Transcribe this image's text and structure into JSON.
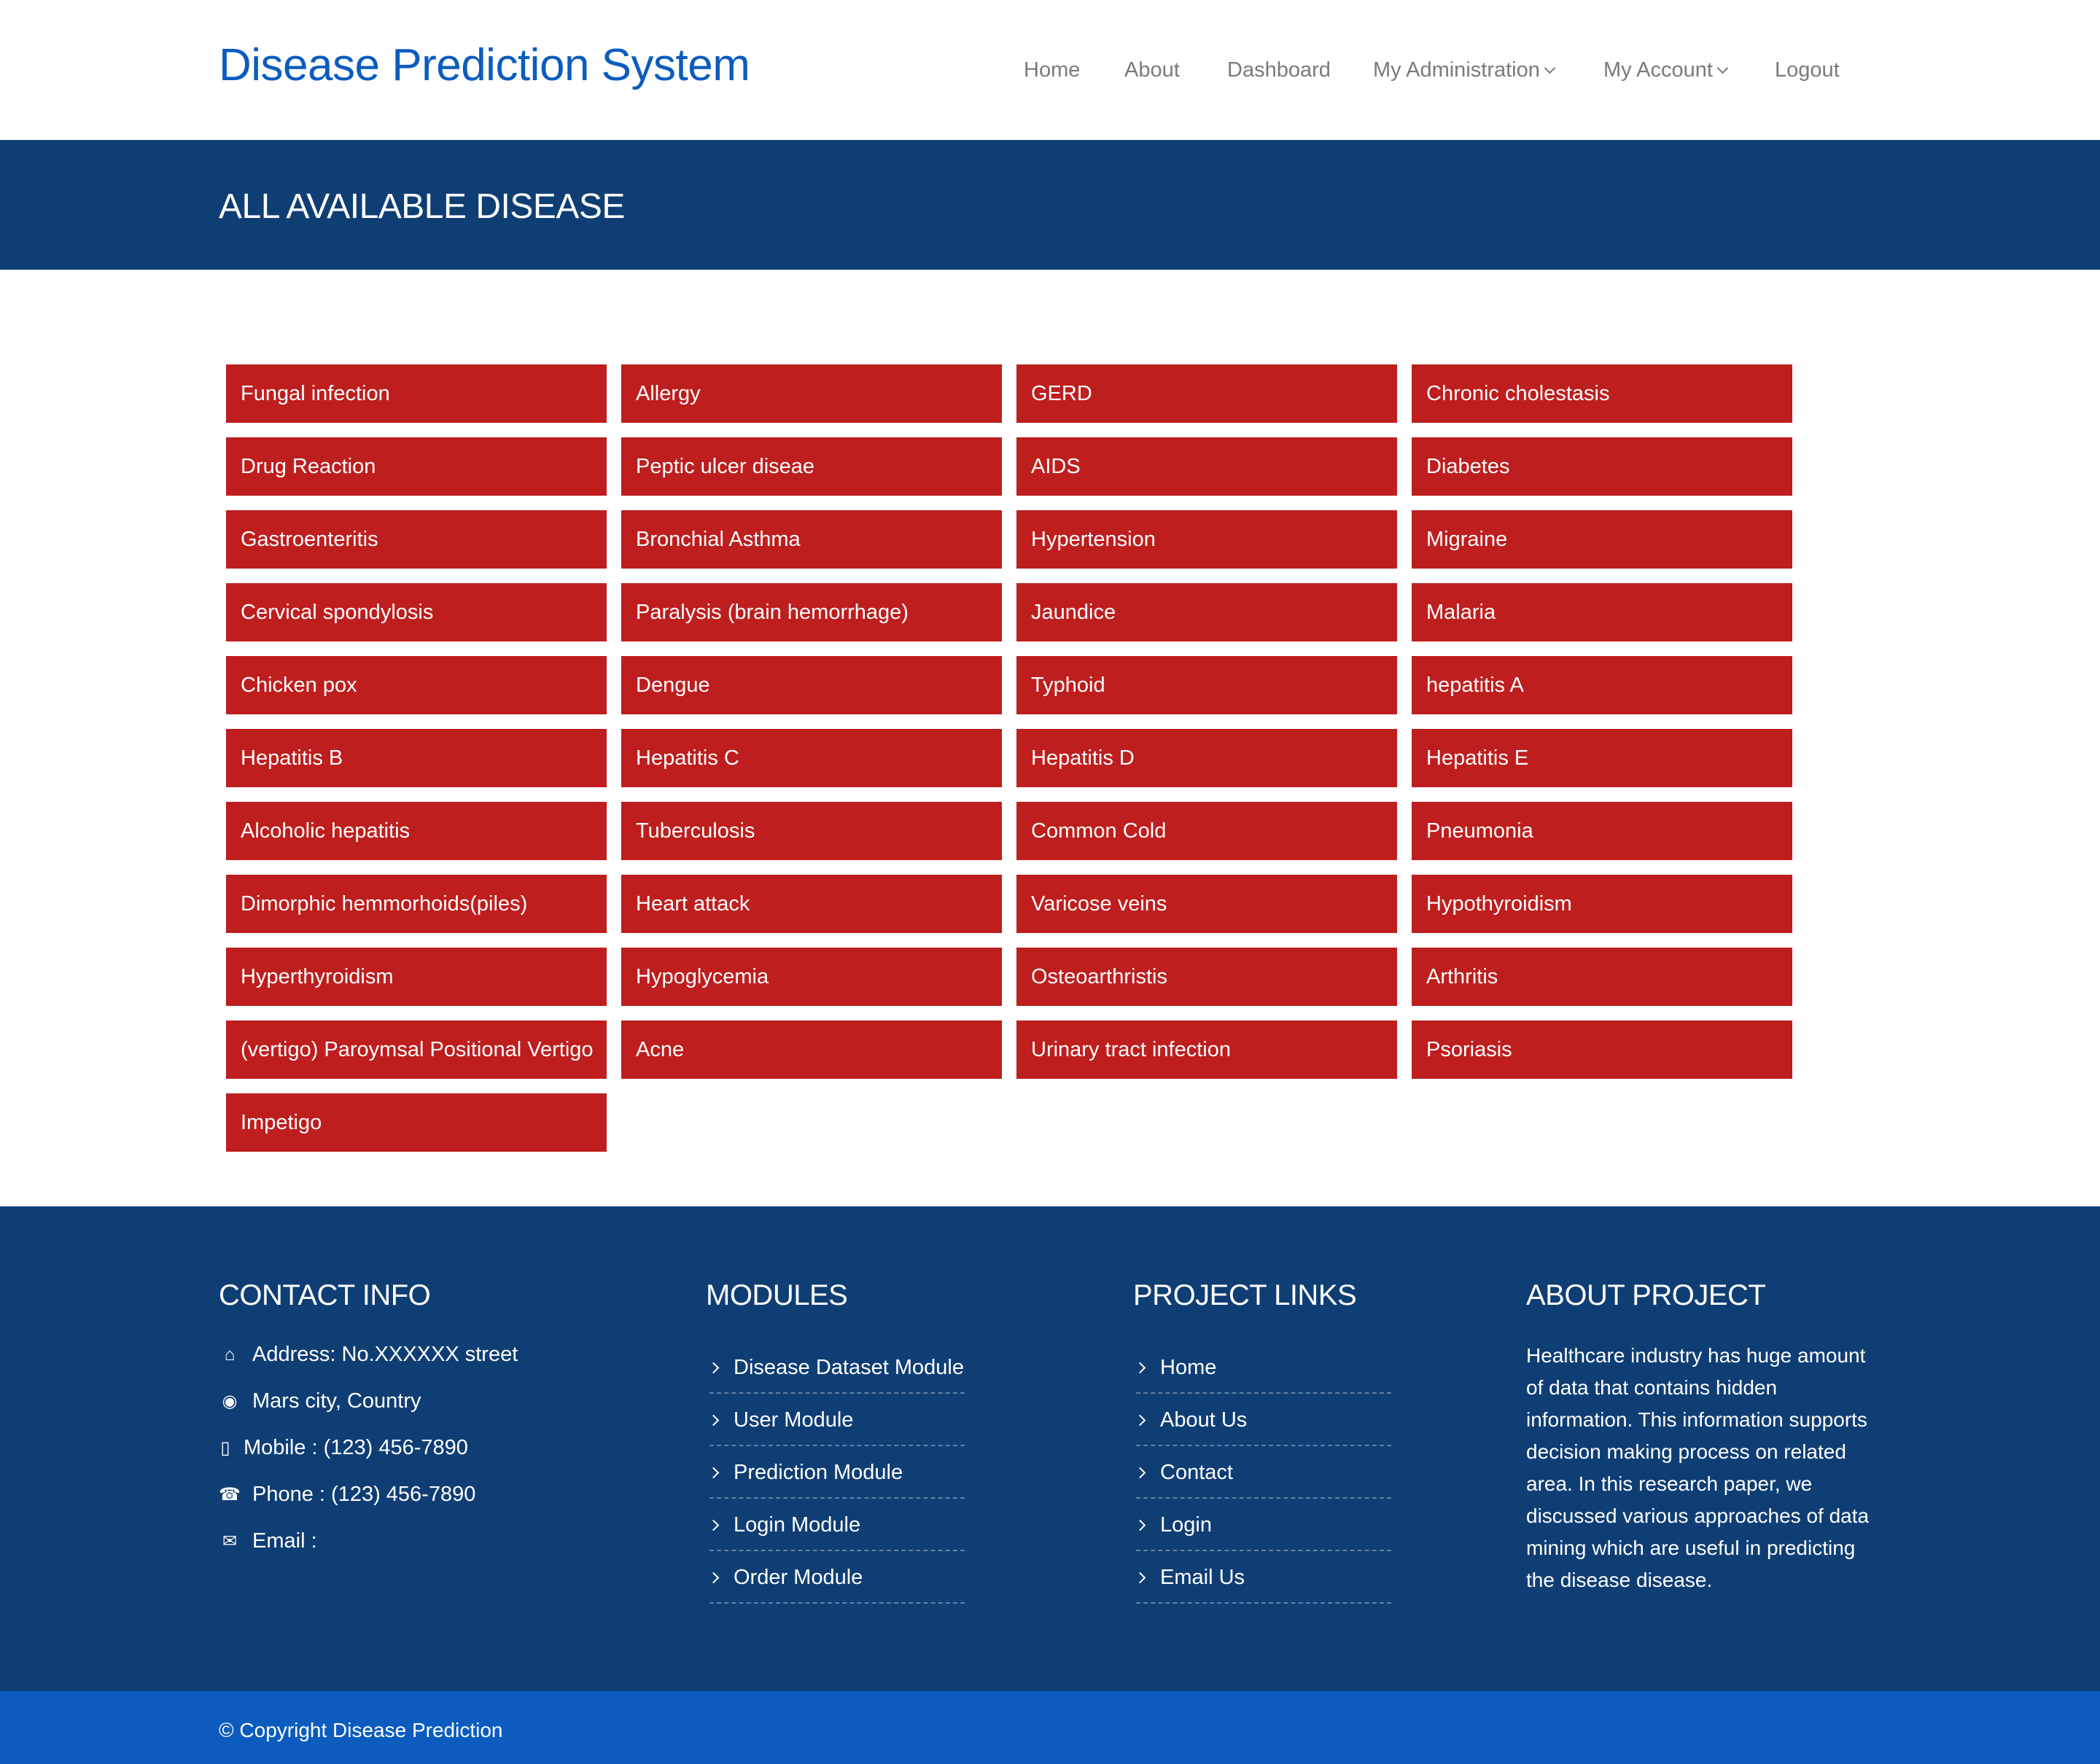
{
  "brand": "Disease Prediction System",
  "nav": {
    "home": "Home",
    "about": "About",
    "dashboard": "Dashboard",
    "administration": "My Administration",
    "account": "My Account",
    "logout": "Logout"
  },
  "page_title": "ALL AVAILABLE DISEASE",
  "diseases": [
    "Fungal infection",
    "Allergy",
    "GERD",
    "Chronic cholestasis",
    "Drug Reaction",
    "Peptic ulcer diseae",
    "AIDS",
    "Diabetes",
    "Gastroenteritis",
    "Bronchial Asthma",
    "Hypertension",
    "Migraine",
    "Cervical spondylosis",
    "Paralysis (brain hemorrhage)",
    "Jaundice",
    "Malaria",
    "Chicken pox",
    "Dengue",
    "Typhoid",
    "hepatitis A",
    "Hepatitis B",
    "Hepatitis C",
    "Hepatitis D",
    "Hepatitis E",
    "Alcoholic hepatitis",
    "Tuberculosis",
    "Common Cold",
    "Pneumonia",
    "Dimorphic hemmorhoids(piles)",
    "Heart attack",
    "Varicose veins",
    "Hypothyroidism",
    "Hyperthyroidism",
    "Hypoglycemia",
    "Osteoarthristis",
    "Arthritis",
    "(vertigo) Paroymsal Positional Vertigo",
    "Acne",
    "Urinary tract infection",
    "Psoriasis",
    "Impetigo"
  ],
  "footer": {
    "contact": {
      "title": "CONTACT INFO",
      "address": "Address: No.XXXXXX street",
      "city": "Mars city, Country",
      "mobile": "Mobile : (123) 456-7890",
      "phone": "Phone : (123) 456-7890",
      "email": "Email :"
    },
    "modules": {
      "title": "MODULES",
      "items": [
        "Disease Dataset Module",
        "User Module",
        "Prediction Module",
        "Login Module",
        "Order Module"
      ]
    },
    "project_links": {
      "title": "PROJECT LINKS",
      "items": [
        "Home",
        "About Us",
        "Contact",
        "Login",
        "Email Us"
      ]
    },
    "about": {
      "title": "ABOUT PROJECT",
      "text": "Healthcare industry has huge amount of data that contains hidden information. This information supports decision making process on related area. In this research paper, we discussed various approaches of data mining which are useful in predicting the disease disease."
    },
    "copyright": "© Copyright Disease Prediction"
  },
  "colors": {
    "brand_blue": "#0b5cbe",
    "navy": "#0f3e74",
    "disease_red": "#be1e1e"
  }
}
